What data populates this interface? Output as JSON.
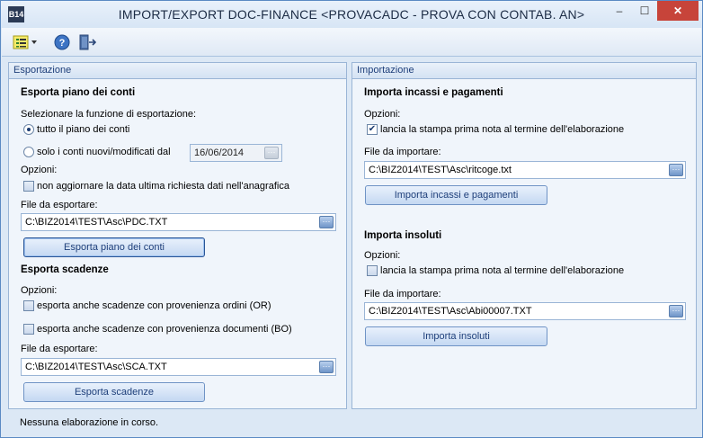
{
  "window": {
    "title": "IMPORT/EXPORT DOC-FINANCE <PROVACADC - PROVA CON CONTAB. AN>",
    "icon_label": "B14",
    "minimize": "–",
    "maximize": "☐",
    "close": "✕"
  },
  "toolbar": {
    "icons": [
      "list-options-icon",
      "help-icon",
      "exit-icon"
    ]
  },
  "export": {
    "header": "Esportazione",
    "piano": {
      "title": "Esporta piano dei conti",
      "function_label": "Selezionare la funzione di esportazione:",
      "radio_all": "tutto il piano dei conti",
      "radio_new": "solo i conti nuovi/modificati dal",
      "date_value": "16/06/2014",
      "options_label": "Opzioni:",
      "checkbox_no_update": "non aggiornare la data ultima richiesta dati nell'anagrafica",
      "file_label": "File da esportare:",
      "file_value": "C:\\BIZ2014\\TEST\\Asc\\PDC.TXT",
      "button": "Esporta piano dei conti"
    },
    "scadenze": {
      "title": "Esporta scadenze",
      "options_label": "Opzioni:",
      "checkbox_or": "esporta anche scadenze con provenienza ordini (OR)",
      "checkbox_bo": "esporta anche scadenze con provenienza documenti (BO)",
      "file_label": "File da esportare:",
      "file_value": "C:\\BIZ2014\\TEST\\Asc\\SCA.TXT",
      "button": "Esporta scadenze"
    }
  },
  "import": {
    "header": "Importazione",
    "incassi": {
      "title": "Importa incassi e pagamenti",
      "options_label": "Opzioni:",
      "checkbox_print": "lancia la stampa prima nota al termine dell'elaborazione",
      "file_label": "File da importare:",
      "file_value": "C:\\BIZ2014\\TEST\\Asc\\ritcoge.txt",
      "button": "Importa incassi e pagamenti"
    },
    "insoluti": {
      "title": "Importa insoluti",
      "options_label": "Opzioni:",
      "checkbox_print": "lancia la stampa prima nota al termine dell'elaborazione",
      "file_label": "File da importare:",
      "file_value": "C:\\BIZ2014\\TEST\\Asc\\Abi00007.TXT",
      "button": "Importa insoluti"
    }
  },
  "status": {
    "text": "Nessuna elaborazione in corso."
  },
  "colors": {
    "accent": "#1e3f7a",
    "panel_border": "#9ab5d6",
    "close_button": "#c7443a"
  }
}
